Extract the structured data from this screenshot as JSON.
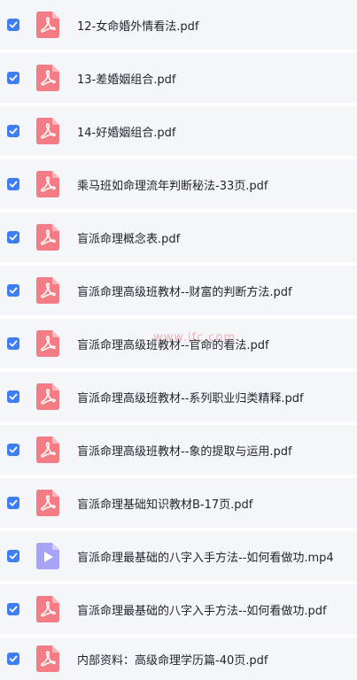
{
  "files": [
    {
      "name": "12-女命婚外情看法.pdf",
      "type": "pdf",
      "checked": true
    },
    {
      "name": "13-差婚姻组合.pdf",
      "type": "pdf",
      "checked": true
    },
    {
      "name": "14-好婚姻组合.pdf",
      "type": "pdf",
      "checked": true
    },
    {
      "name": "乘马班如命理流年判断秘法-33页.pdf",
      "type": "pdf",
      "checked": true
    },
    {
      "name": "盲派命理概念表.pdf",
      "type": "pdf",
      "checked": true
    },
    {
      "name": "盲派命理高级班教材--财富的判断方法.pdf",
      "type": "pdf",
      "checked": true
    },
    {
      "name": "盲派命理高级班教材--官命的看法.pdf",
      "type": "pdf",
      "checked": true
    },
    {
      "name": "盲派命理高级班教材--系列职业归类精释.pdf",
      "type": "pdf",
      "checked": true
    },
    {
      "name": "盲派命理高级班教材--象的提取与运用.pdf",
      "type": "pdf",
      "checked": true
    },
    {
      "name": "盲派命理基础知识教材B-17页.pdf",
      "type": "pdf",
      "checked": true
    },
    {
      "name": "盲派命理最基础的八字入手方法--如何看做功.mp4",
      "type": "mp4",
      "checked": true
    },
    {
      "name": "盲派命理最基础的八字入手方法--如何看做功.pdf",
      "type": "pdf",
      "checked": true
    },
    {
      "name": "内部资料：高级命理学历篇-40页.pdf",
      "type": "pdf",
      "checked": true
    }
  ],
  "watermark": "www.ifc.com",
  "colors": {
    "row_bg": "#f5f6fa",
    "checkbox": "#3d7df5",
    "pdf_icon": "#f47c84",
    "mp4_icon": "#a7a3f6",
    "text": "#1f2329"
  },
  "icons": {
    "pdf": "pdf-file-icon",
    "mp4": "video-file-icon",
    "check": "checkmark-icon"
  }
}
